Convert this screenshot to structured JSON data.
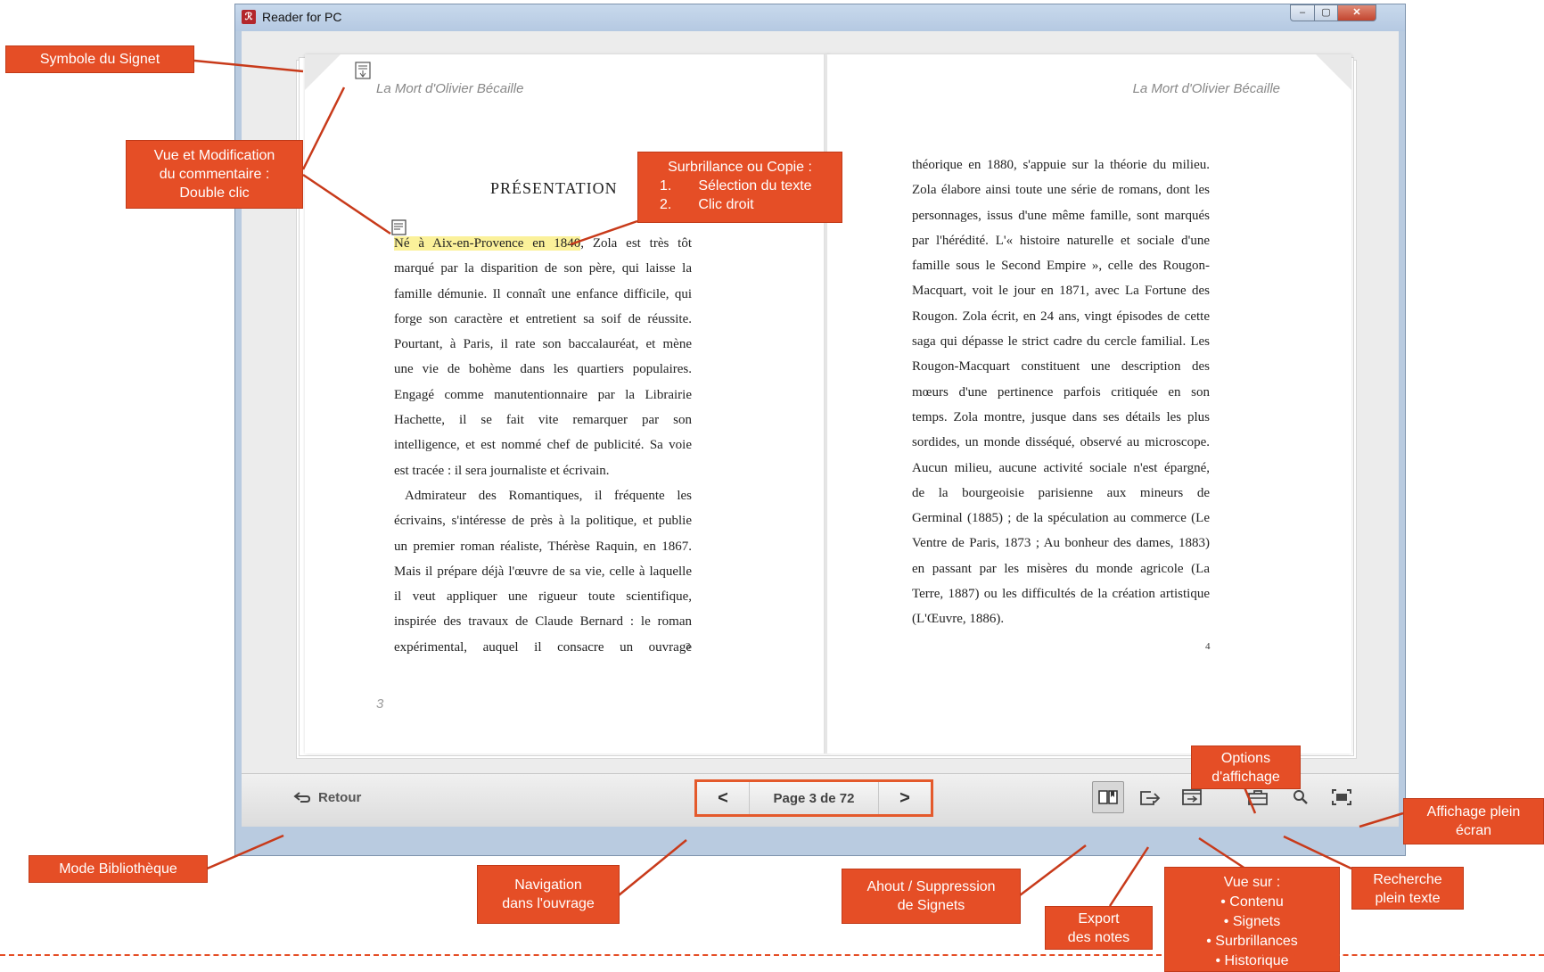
{
  "window": {
    "title": "Reader for PC",
    "app_icon": "reader-app-icon",
    "controls": {
      "minimize": "‒",
      "maximize": "▢",
      "close": "✕"
    }
  },
  "book": {
    "running_head_left": "La Mort d'Olivier Bécaille",
    "running_head_right": "La Mort d'Olivier Bécaille",
    "heading": "PRÉSENTATION",
    "left_page": {
      "highlight": "Né à Aix-en-Provence en 1840",
      "first_line_rest": ", Zola est très tôt",
      "lines": [
        "marqué par la disparition de son père, qui laisse la",
        "famille démunie. Il connaît une enfance difficile, qui",
        "forge son caractère et entretient sa soif de réussite.",
        "Pourtant, à Paris, il rate son baccalauréat, et mène",
        "une vie de bohème dans les quartiers populaires.",
        "Engagé comme manutentionnaire par la Librairie",
        "Hachette, il se fait vite remarquer par son",
        "intelligence, et est nommé chef de publicité. Sa voie",
        "est tracée : il sera journaliste et écrivain."
      ],
      "para2_lines": [
        "Admirateur des Romantiques, il fréquente les",
        "écrivains, s'intéresse de près à la politique, et publie",
        "un premier roman réaliste, Thérèse Raquin, en 1867.",
        "Mais il prépare déjà l'œuvre de sa vie, celle à laquelle",
        "il veut appliquer une rigueur toute scientifique,",
        "inspirée des travaux de Claude Bernard : le roman",
        "expérimental, auquel il consacre un ouvrage"
      ],
      "folio": "3",
      "footer_number": "3"
    },
    "right_page": {
      "lines": [
        "théorique en 1880, s'appuie sur la théorie du milieu.",
        "Zola élabore ainsi toute une série de romans, dont les",
        "personnages, issus d'une même famille, sont marqués",
        "par l'hérédité. L'« histoire naturelle et sociale d'une",
        "famille sous le Second Empire », celle des Rougon-",
        "Macquart, voit le jour en 1871, avec La Fortune des",
        "Rougon. Zola écrit, en 24 ans, vingt épisodes de cette",
        "saga qui dépasse le strict cadre du cercle familial. Les",
        "Rougon-Macquart constituent une description des",
        "mœurs d'une pertinence parfois critiquée en son",
        "temps. Zola montre, jusque dans ses détails les plus",
        "sordides, un monde disséqué, observé au microscope.",
        "Aucun milieu, aucune activité sociale n'est épargné,",
        "de la bourgeoisie parisienne aux mineurs de",
        "Germinal (1885) ; de la spéculation au commerce (Le",
        "Ventre de Paris, 1873 ; Au bonheur des dames, 1883)",
        "en passant par les misères du monde agricole (La",
        "Terre, 1887) ou les difficultés de la création artistique",
        "(L'Œuvre, 1886)."
      ],
      "folio": "4"
    }
  },
  "bottombar": {
    "retour_label": "Retour",
    "nav_prev": "<",
    "nav_next": ">",
    "page_label": "Page 3 de 72"
  },
  "annotations": {
    "signet": "Symbole du Signet",
    "commentaire": [
      "Vue et Modification",
      "du commentaire :",
      "Double clic"
    ],
    "surbrillance": [
      "Surbrillance ou Copie :",
      "1.",
      "Sélection du texte",
      "2.",
      "Clic droit"
    ],
    "options": [
      "Options",
      "d'affichage"
    ],
    "plein_ecran": [
      "Affichage plein",
      "écran"
    ],
    "bibliotheque": "Mode Bibliothèque",
    "navigation": [
      "Navigation",
      "dans l'ouvrage"
    ],
    "signets": [
      "Ahout / Suppression",
      "de Signets"
    ],
    "export": [
      "Export",
      "des notes"
    ],
    "vue_sur": [
      "Vue sur :",
      "• Contenu",
      "• Signets",
      "• Surbrillances",
      "• Historique"
    ],
    "recherche": [
      "Recherche",
      "plein texte"
    ]
  },
  "colors": {
    "annotation": "#e54e26",
    "highlight": "#fbf19a",
    "nav_border": "#e45a2c"
  }
}
